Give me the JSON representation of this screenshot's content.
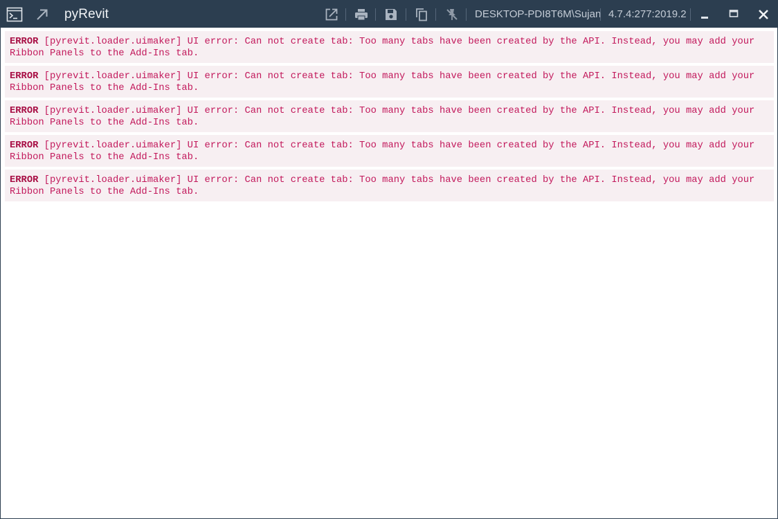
{
  "titlebar": {
    "app_title": "pyRevit",
    "user": "DESKTOP-PDI8T6M\\Sujan",
    "version": "4.7.4:277:2019.2",
    "background_color": "#2c3e50",
    "icons": {
      "terminal": "terminal-icon",
      "expand": "diagonal-arrow-icon",
      "open_external": "open-external-icon",
      "print": "print-icon",
      "save": "save-icon",
      "copy": "copy-icon",
      "pin": "unpin-icon",
      "minimize": "minimize-icon",
      "maximize": "maximize-icon",
      "close": "close-icon"
    }
  },
  "log": {
    "entries": [
      {
        "level": "ERROR",
        "message": " [pyrevit.loader.uimaker] UI error: Can not create tab: Too many tabs have been created by the API. Instead, you may add your Ribbon Panels to the Add-Ins tab."
      },
      {
        "level": "ERROR",
        "message": " [pyrevit.loader.uimaker] UI error: Can not create tab: Too many tabs have been created by the API. Instead, you may add your Ribbon Panels to the Add-Ins tab."
      },
      {
        "level": "ERROR",
        "message": " [pyrevit.loader.uimaker] UI error: Can not create tab: Too many tabs have been created by the API. Instead, you may add your Ribbon Panels to the Add-Ins tab."
      },
      {
        "level": "ERROR",
        "message": " [pyrevit.loader.uimaker] UI error: Can not create tab: Too many tabs have been created by the API. Instead, you may add your Ribbon Panels to the Add-Ins tab."
      },
      {
        "level": "ERROR",
        "message": " [pyrevit.loader.uimaker] UI error: Can not create tab: Too many tabs have been created by the API. Instead, you may add your Ribbon Panels to the Add-Ins tab."
      }
    ],
    "error_color": "#c2185b",
    "entry_background": "#f7eff2"
  }
}
